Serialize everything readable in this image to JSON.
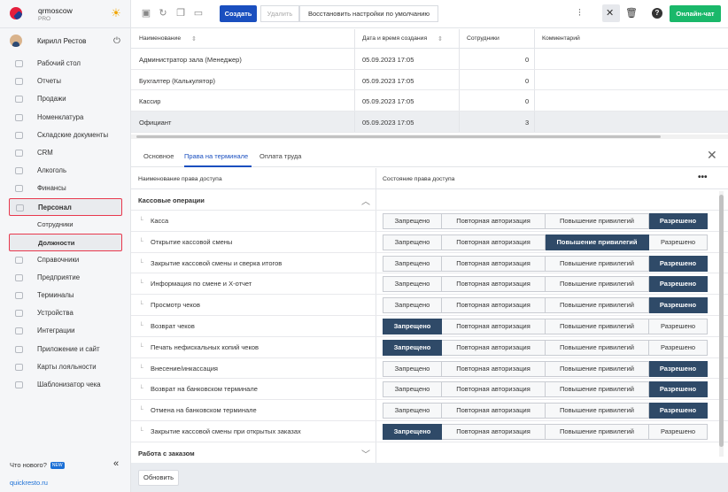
{
  "brand": {
    "name": "qrmoscow",
    "plan": "PRO"
  },
  "user": {
    "name": "Кирилл Рестов"
  },
  "sidebar": {
    "items": [
      {
        "label": "Рабочий стол",
        "icon": "desktop-icon"
      },
      {
        "label": "Отчеты",
        "icon": "chart-icon"
      },
      {
        "label": "Продажи",
        "icon": "bag-icon"
      },
      {
        "label": "Номенклатура",
        "icon": "tag-icon"
      },
      {
        "label": "Складские документы",
        "icon": "box-icon"
      },
      {
        "label": "CRM",
        "icon": "crm-icon"
      },
      {
        "label": "Алкоголь",
        "icon": "glass-icon"
      },
      {
        "label": "Финансы",
        "icon": "wallet-icon"
      },
      {
        "label": "Персонал",
        "icon": "people-icon"
      }
    ],
    "personnel_subitems": [
      "Сотрудники",
      "Должности"
    ],
    "items_after": [
      {
        "label": "Справочники",
        "icon": "book-icon"
      },
      {
        "label": "Предприятие",
        "icon": "building-icon"
      },
      {
        "label": "Терминалы",
        "icon": "terminal-icon"
      },
      {
        "label": "Устройства",
        "icon": "printer-icon"
      },
      {
        "label": "Интеграции",
        "icon": "link-icon"
      },
      {
        "label": "Приложение и сайт",
        "icon": "app-icon"
      },
      {
        "label": "Карты лояльности",
        "icon": "card-icon"
      },
      {
        "label": "Шаблонизатор чека",
        "icon": "receipt-icon"
      }
    ],
    "whats_new": "Что нового?",
    "new_badge": "NEW",
    "site": "quickresto.ru"
  },
  "toolbar": {
    "create": "Создать",
    "delete": "Удалить",
    "restore": "Восстановить настройки по умолчанию",
    "chat": "Онлайн-чат"
  },
  "roles_table": {
    "columns": [
      "Наименование",
      "Дата и время создания",
      "Сотрудники",
      "Комментарий"
    ],
    "rows": [
      {
        "name": "Администратор зала (Менеджер)",
        "date": "05.09.2023 17:05",
        "count": "0",
        "comment": ""
      },
      {
        "name": "Бухгалтер (Калькулятор)",
        "date": "05.09.2023 17:05",
        "count": "0",
        "comment": ""
      },
      {
        "name": "Кассир",
        "date": "05.09.2023 17:05",
        "count": "0",
        "comment": ""
      },
      {
        "name": "Официант",
        "date": "05.09.2023 17:05",
        "count": "3",
        "comment": ""
      }
    ],
    "selected_row": 3
  },
  "tabs": [
    "Основное",
    "Права на терминале",
    "Оплата труда"
  ],
  "active_tab": 1,
  "permissions": {
    "col_name": "Наименование права доступа",
    "col_state": "Состояние права доступа",
    "options": [
      "Запрещено",
      "Повторная авторизация",
      "Повышение привилегий",
      "Разрешено"
    ],
    "group1": "Кассовые операции",
    "group2": "Работа с заказом",
    "rows": [
      {
        "name": "Касса",
        "state": 3
      },
      {
        "name": "Открытие кассовой смены",
        "state": 2
      },
      {
        "name": "Закрытие кассовой смены и сверка итогов",
        "state": 3
      },
      {
        "name": "Информация по смене и Х-отчет",
        "state": 3
      },
      {
        "name": "Просмотр чеков",
        "state": 3
      },
      {
        "name": "Возврат чеков",
        "state": 0
      },
      {
        "name": "Печать нефискальных копий чеков",
        "state": 0
      },
      {
        "name": "Внесение/инкассация",
        "state": 3
      },
      {
        "name": "Возврат на банковском терминале",
        "state": 3
      },
      {
        "name": "Отмена на банковском терминале",
        "state": 3
      },
      {
        "name": "Закрытие кассовой смены при открытых заказах",
        "state": 0
      }
    ]
  },
  "footer": {
    "refresh": "Обновить"
  }
}
